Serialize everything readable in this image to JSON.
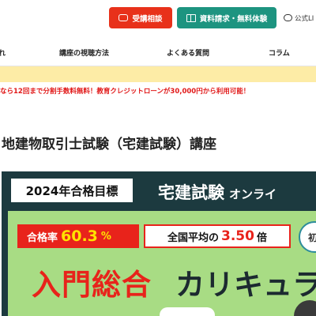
{
  "header": {
    "consult_label": "受講相談",
    "request_label": "資料請求・無料体験",
    "line_label": "公式LI",
    "colors": {
      "consult": "#e8311a",
      "request": "#1d9480"
    },
    "icons": {
      "consult": "chat-icon",
      "request": "book-icon",
      "line": "line-icon"
    }
  },
  "nav": {
    "items": [
      "れ",
      "講座の視聴方法",
      "よくある質問",
      "コラム"
    ]
  },
  "notice": {
    "text": "なら12回まで分割手数料無料！教育クレジットローンが30,000円から利用可能！",
    "color": "#e11919"
  },
  "page": {
    "title": "地建物取引士試験（宅建試験）講座"
  },
  "hero": {
    "goal": "2024年合格目標",
    "heading_main": "宅建試験",
    "heading_sub": "オンライ",
    "rate_label": "合格率",
    "rate_value": "60.3",
    "rate_unit": "%",
    "avg_prefix": "全国平均の",
    "avg_value": "3.50",
    "avg_suffix": "倍",
    "circle_text": "初",
    "intro_red": "入門総合",
    "intro_dark": "カリキュラ"
  }
}
